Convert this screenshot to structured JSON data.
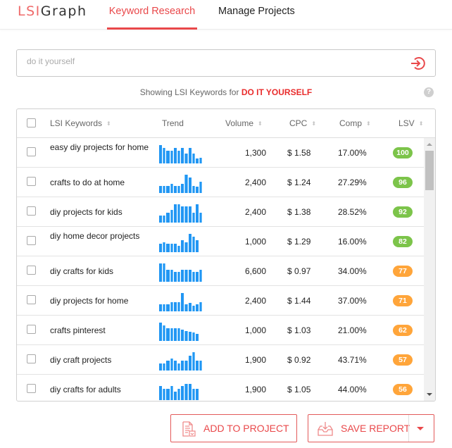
{
  "app": {
    "logo_part1": "LSI",
    "logo_part2": "Graph",
    "nav": [
      {
        "label": "Keyword Research",
        "active": true
      },
      {
        "label": "Manage Projects",
        "active": false
      }
    ]
  },
  "search": {
    "placeholder": "do it yourself",
    "value": "",
    "submit_icon": "sign-in-arrow-icon"
  },
  "result_summary": {
    "prefix": "Showing LSI Keywords for",
    "keyword": "DO IT YOURSELF",
    "help_icon": "?"
  },
  "table": {
    "columns": [
      {
        "label": "LSI Keywords",
        "sortable": true
      },
      {
        "label": "Trend",
        "sortable": false
      },
      {
        "label": "Volume",
        "sortable": true
      },
      {
        "label": "CPC",
        "sortable": true
      },
      {
        "label": "Comp",
        "sortable": true
      },
      {
        "label": "LSV",
        "sortable": true
      }
    ],
    "sort_glyph": "⬍",
    "rows": [
      {
        "keyword": "easy diy projects for home",
        "trend": [
          100,
          85,
          70,
          70,
          85,
          70,
          85,
          55,
          85,
          55,
          25,
          30
        ],
        "volume": "1,300",
        "cpc": "$ 1.58",
        "comp": "17.00%",
        "lsv": "100",
        "lsv_color": "green"
      },
      {
        "keyword": "crafts to do at home",
        "trend": [
          40,
          40,
          40,
          50,
          40,
          40,
          50,
          100,
          85,
          40,
          35,
          60
        ],
        "volume": "2,400",
        "cpc": "$ 1.24",
        "comp": "27.29%",
        "lsv": "96",
        "lsv_color": "green"
      },
      {
        "keyword": "diy projects for kids",
        "trend": [
          40,
          40,
          55,
          70,
          100,
          100,
          90,
          90,
          90,
          55,
          100,
          55
        ],
        "volume": "2,400",
        "cpc": "$ 1.38",
        "comp": "28.52%",
        "lsv": "92",
        "lsv_color": "green"
      },
      {
        "keyword": "diy home decor projects",
        "trend": [
          45,
          55,
          45,
          45,
          45,
          35,
          65,
          55,
          100,
          85,
          65
        ],
        "volume": "1,000",
        "cpc": "$ 1.29",
        "comp": "16.00%",
        "lsv": "82",
        "lsv_color": "green"
      },
      {
        "keyword": "diy crafts for kids",
        "trend": [
          100,
          100,
          65,
          65,
          55,
          55,
          65,
          65,
          65,
          55,
          55,
          65
        ],
        "volume": "6,600",
        "cpc": "$ 0.97",
        "comp": "34.00%",
        "lsv": "77",
        "lsv_color": "orange"
      },
      {
        "keyword": "diy projects for home",
        "trend": [
          40,
          40,
          40,
          50,
          50,
          50,
          100,
          40,
          45,
          30,
          40,
          50
        ],
        "volume": "2,400",
        "cpc": "$ 1.44",
        "comp": "37.00%",
        "lsv": "71",
        "lsv_color": "orange"
      },
      {
        "keyword": "crafts pinterest",
        "trend": [
          100,
          85,
          70,
          70,
          70,
          70,
          60,
          55,
          50,
          45,
          40
        ],
        "volume": "1,000",
        "cpc": "$ 1.03",
        "comp": "21.00%",
        "lsv": "62",
        "lsv_color": "orange"
      },
      {
        "keyword": "diy craft projects",
        "trend": [
          40,
          40,
          55,
          65,
          55,
          40,
          55,
          55,
          80,
          100,
          55,
          55
        ],
        "volume": "1,900",
        "cpc": "$ 0.92",
        "comp": "43.71%",
        "lsv": "57",
        "lsv_color": "orange"
      },
      {
        "keyword": "diy crafts for adults",
        "trend": [
          75,
          60,
          60,
          75,
          45,
          60,
          75,
          90,
          90,
          60,
          60
        ],
        "volume": "1,900",
        "cpc": "$ 1.05",
        "comp": "44.00%",
        "lsv": "56",
        "lsv_color": "orange"
      }
    ]
  },
  "actions": {
    "add_to_project": "ADD TO PROJECT",
    "save_report": "SAVE REPORT"
  },
  "colors": {
    "accent": "#e9484a",
    "lsv_green": "#7cc44a",
    "lsv_orange": "#ffa53a",
    "trend_bar": "#2196f3"
  }
}
